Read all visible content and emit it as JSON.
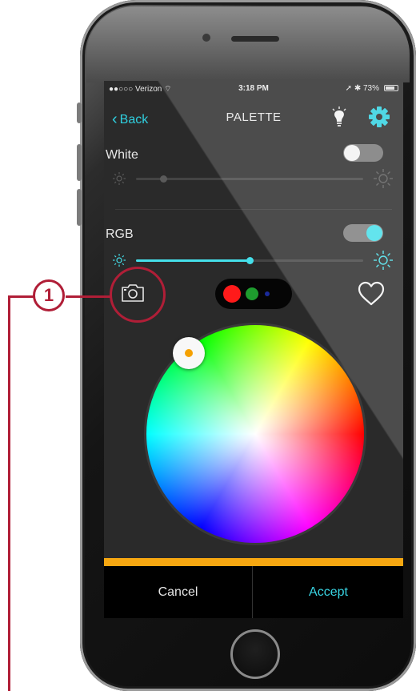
{
  "status_bar": {
    "carrier": "●●○○○ Verizon",
    "time": "3:18 PM",
    "battery": "73%"
  },
  "navbar": {
    "back_label": "Back",
    "title": "PALETTE",
    "icons": [
      "lightbulb-icon",
      "gear-icon"
    ]
  },
  "white": {
    "label": "White",
    "toggle_on": false,
    "brightness": 0.12
  },
  "rgb": {
    "label": "RGB",
    "toggle_on": true,
    "brightness": 0.5
  },
  "colors": {
    "accent": "#45dfea",
    "swatches": [
      "#ff1a1a",
      "#1e9c2e",
      "#1a2a9a"
    ],
    "bar": "#f6a711",
    "callout": "#b01e37"
  },
  "actions": {
    "cancel": "Cancel",
    "accept": "Accept"
  },
  "callout": {
    "number": "1"
  }
}
